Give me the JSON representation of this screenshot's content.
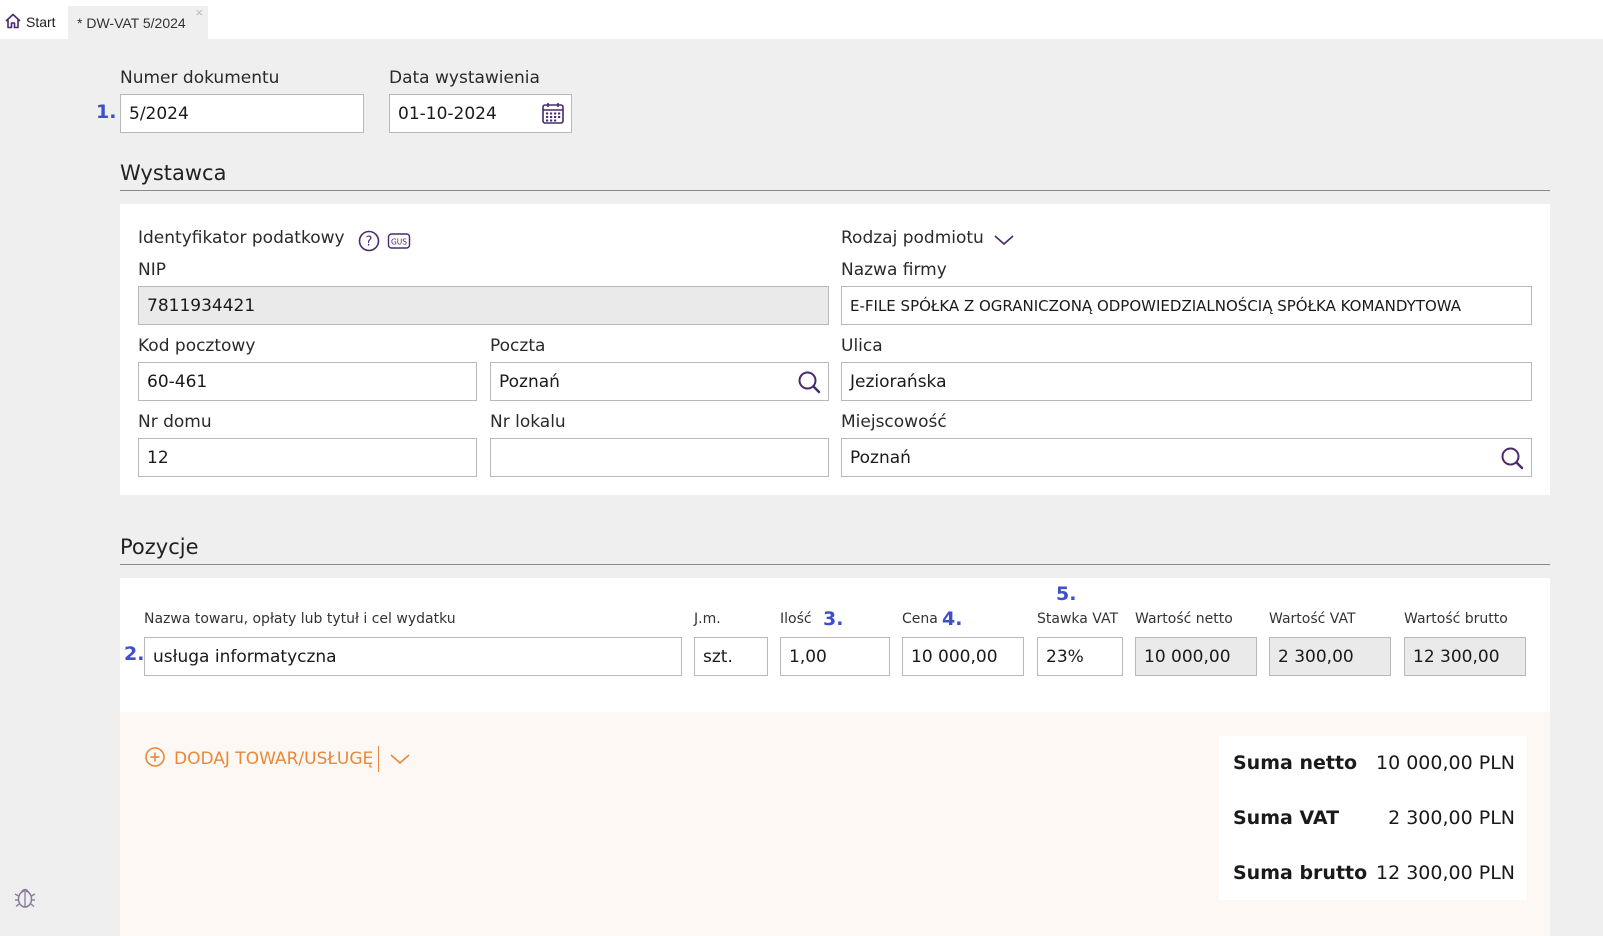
{
  "tabs": {
    "start_label": "Start",
    "doc_label": "* DW-VAT 5/2024",
    "close_glyph": "×"
  },
  "header": {
    "doc_number_label": "Numer dokumentu",
    "doc_number_value": "5/2024",
    "issue_date_label": "Data wystawienia",
    "issue_date_value": "01-10-2024"
  },
  "markers": {
    "m1": "1.",
    "m2": "2.",
    "m3": "3.",
    "m4": "4.",
    "m5": "5."
  },
  "issuer": {
    "section_title": "Wystawca",
    "tax_id_heading": "Identyfikator podatkowy",
    "help_icon_glyph": "?",
    "gus_label": "GUS",
    "nip_label": "NIP",
    "nip_value": "7811934421",
    "entity_type_label": "Rodzaj podmiotu",
    "company_name_label": "Nazwa firmy",
    "company_name_value": "E-FILE SPÓŁKA Z OGRANICZONĄ ODPOWIEDZIALNOŚCIĄ SPÓŁKA KOMANDYTOWA",
    "postal_code_label": "Kod pocztowy",
    "postal_code_value": "60-461",
    "post_office_label": "Poczta",
    "post_office_value": "Poznań",
    "street_label": "Ulica",
    "street_value": "Jeziorańska",
    "house_no_label": "Nr domu",
    "house_no_value": "12",
    "unit_no_label": "Nr lokalu",
    "unit_no_value": "",
    "city_label": "Miejscowość",
    "city_value": "Poznań"
  },
  "items": {
    "section_title": "Pozycje",
    "columns": {
      "name": "Nazwa towaru, opłaty lub tytuł i cel wydatku",
      "unit": "J.m.",
      "qty": "Ilość",
      "price": "Cena",
      "vat_rate": "Stawka VAT",
      "net": "Wartość netto",
      "vat": "Wartość VAT",
      "gross": "Wartość brutto"
    },
    "rows": [
      {
        "name": "usługa informatyczna",
        "unit": "szt.",
        "qty": "1,00",
        "price": "10 000,00",
        "vat_rate": "23%",
        "net": "10 000,00",
        "vat": "2 300,00",
        "gross": "12 300,00"
      }
    ],
    "add_button_label": "DODAJ TOWAR/USŁUGĘ"
  },
  "summary": {
    "net_label": "Suma netto",
    "net_value": "10 000,00 PLN",
    "vat_label": "Suma VAT",
    "vat_value": "2 300,00 PLN",
    "gross_label": "Suma brutto",
    "gross_value": "12 300,00 PLN"
  },
  "colors": {
    "marker": "#3d50c9",
    "icon_purple": "#4a2a6a",
    "accent_orange": "#e8893a",
    "footer_bg": "#fdf8f4"
  },
  "icons": {
    "home": "home-icon",
    "calendar": "calendar-icon",
    "help": "help-icon",
    "gus": "gus-icon",
    "chevron": "chevron-down-icon",
    "search": "search-icon",
    "add": "plus-circle-icon",
    "bug": "bug-icon"
  }
}
